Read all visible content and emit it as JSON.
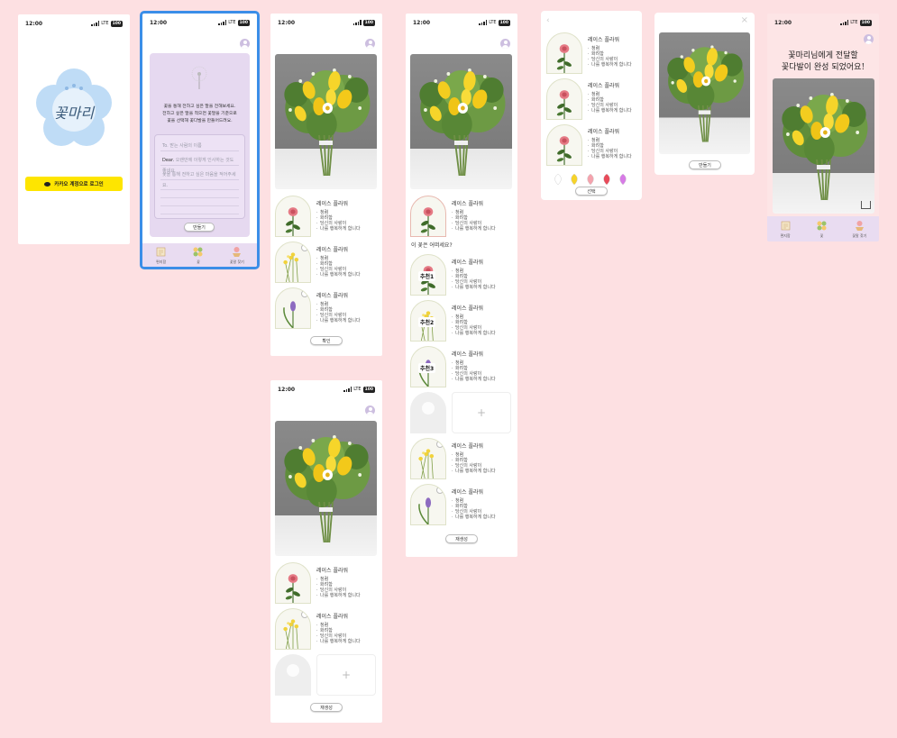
{
  "status": {
    "time": "12:00",
    "network": "LTE",
    "battery": "100"
  },
  "login": {
    "logo_text": "꽃마리",
    "kakao_button": "카카오 계정으로 로그인"
  },
  "compose": {
    "intro_line1": "꽃을 통해 전하고 싶은 말을 전해보세요.",
    "intro_line2": "전하고 싶은 말을 적으면 꽃말을 기준으로",
    "intro_line3": "꽃을 선택해 꽃다발을 만들어드려요.",
    "to_placeholder": "To. 받는 사람의 이름",
    "dear_label": "Dear.",
    "dear_placeholder": "오랜만에 이렇게 인사하는 것도 좋네요",
    "msg_placeholder": "꽃을 통해 전하고 싶은 마음을 적어주세요.",
    "make_button": "만들기"
  },
  "tabs": [
    {
      "label": "편지함"
    },
    {
      "label": "꽃"
    },
    {
      "label": "꽃말 찾기"
    }
  ],
  "flower": {
    "name": "레이스 플라워",
    "m1": "청렴",
    "m2": "화려함",
    "m3": "당신의 사랑이",
    "m4": "나를 행복하게 합니다"
  },
  "detail": {
    "confirm_button": "확인",
    "regen_button": "재생성",
    "recommend_title": "이 꽃은 어떠세요?",
    "rec1": "추천1",
    "rec2": "추천2",
    "rec3": "추천3"
  },
  "picker": {
    "select_button": "선택"
  },
  "preview": {
    "make_button": "만들기"
  },
  "done": {
    "line1": "꽃마리님에게 전달할",
    "line2": "꽃다발이 완성 되었어요!"
  },
  "colors": {
    "background": "#fde0e2",
    "selection": "#3b8ee8",
    "kakao": "#fee500",
    "lavender": "#e9dcf1"
  },
  "swatches": [
    "#ffffff",
    "#f6d32a",
    "#f4a3ad",
    "#e84b5a",
    "#d77be6"
  ]
}
